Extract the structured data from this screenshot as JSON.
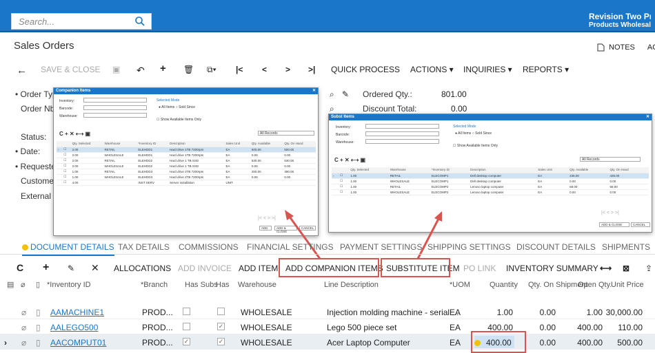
{
  "search": {
    "placeholder": "Search..."
  },
  "company": {
    "line1": "Revision Two Pro",
    "line2": "Products Wholesale"
  },
  "page": {
    "title": "Sales Orders",
    "notes": "NOTES",
    "act": "ACT"
  },
  "toolbar": {
    "save_close": "SAVE & CLOSE",
    "quick_process": "QUICK PROCESS",
    "actions": "ACTIONS ▾",
    "inquiries": "INQUIRIES ▾",
    "reports": "REPORTS ▾"
  },
  "header": {
    "order_type": "• Order Type",
    "order_nbr": "Order Nbr.",
    "status": "Status:",
    "date": "• Date:",
    "requested": "• Requested",
    "customer": "Customer",
    "external": "External R",
    "ordered_qty_label": "Ordered Qty.:",
    "ordered_qty": "801.00",
    "discount_label": "Discount Total:",
    "discount": "0.00"
  },
  "companion": {
    "title": "Companion Items",
    "inventory": "Inventory:",
    "barcode": "Barcode:",
    "warehouse": "Warehouse:",
    "selected_mode": "Selected Mode",
    "mode_options": "● All Items  ○ Sold Since",
    "show_available": "☐ Show Available Items Only",
    "all_records": "All Records",
    "columns": [
      "Qty. Selected",
      "Warehouse",
      "*Inventory ID",
      "Description",
      "Sales Unit",
      "Qty. Available",
      "Qty. On Hand"
    ],
    "rows": [
      [
        "2.00",
        "RETAIL",
        "ELEHDD1",
        "Hard drive 1TB 7200rpm",
        "EA",
        "500.00",
        "500.00"
      ],
      [
        "2.00",
        "WHOLESALE",
        "ELEHDD1",
        "Hard drive 1TB 7200rpm",
        "EA",
        "0.00",
        "0.00"
      ],
      [
        "2.00",
        "RETAIL",
        "ELEHDD2",
        "Hard drive 1 TB SSD",
        "EA",
        "530.00",
        "530.00"
      ],
      [
        "2.00",
        "WHOLESALE",
        "ELEHDD2",
        "Hard drive 1 TB SSD",
        "EA",
        "0.00",
        "0.00"
      ],
      [
        "1.00",
        "RETAIL",
        "ELEHDD3",
        "Hard drive 2TB 7200rpm",
        "EA",
        "250.00",
        "390.00"
      ],
      [
        "1.00",
        "WHOLESALE",
        "ELEHDD3",
        "Hard drive 2TB 7200rpm",
        "EA",
        "0.00",
        "0.00"
      ],
      [
        "4.00",
        "",
        "INST SERV",
        "Server installation",
        "UNIT",
        "",
        ""
      ]
    ],
    "add": "ADD",
    "add_close": "ADD & CLOSE",
    "cancel": "CANCEL"
  },
  "subst": {
    "title": "Subst Items",
    "inventory": "Inventory:",
    "barcode": "Barcode:",
    "warehouse": "Warehouse:",
    "selected_mode": "Selected Mode",
    "mode_options": "● All Items  ○ Sold Since",
    "show_available": "☐ Show Available Items Only",
    "all_records": "All Records",
    "columns": [
      "Qty. Selected",
      "Warehouse",
      "*Inventory ID",
      "Description",
      "Sales Unit",
      "Qty. Available",
      "Qty. On Hand"
    ],
    "rows": [
      [
        "1.00",
        "RETAIL",
        "ELECOMP1",
        "Dell desktop computer",
        "EA",
        "435.00",
        "435.00"
      ],
      [
        "1.00",
        "WHOLESALE",
        "ELECOMP1",
        "Dell desktop computer",
        "EA",
        "0.00",
        "0.00"
      ],
      [
        "1.00",
        "RETAIL",
        "ELECOMP2",
        "Lenovo laptop computer",
        "EA",
        "68.00",
        "68.00"
      ],
      [
        "1.00",
        "WHOLESALE",
        "ELECOMP2",
        "Lenovo laptop computer",
        "EA",
        "0.00",
        "0.00"
      ]
    ],
    "add_close": "ADD & CLOSE",
    "cancel": "CANCEL"
  },
  "tabs": [
    "DOCUMENT DETAILS",
    "TAX DETAILS",
    "COMMISSIONS",
    "FINANCIAL SETTINGS",
    "PAYMENT SETTINGS",
    "SHIPPING SETTINGS",
    "DISCOUNT DETAILS",
    "SHIPMENTS"
  ],
  "gridbar": {
    "allocations": "ALLOCATIONS",
    "add_invoice": "ADD INVOICE",
    "add_item": "ADD ITEM",
    "add_companion": "ADD COMPANION ITEMS",
    "substitute": "SUBSTITUTE ITEM",
    "po_link": "PO LINK",
    "inventory_summary": "INVENTORY SUMMARY"
  },
  "grid": {
    "columns": [
      "*Inventory ID",
      "*Branch",
      "Has Subs",
      "Has Cor",
      "Warehouse",
      "Line Description",
      "*UOM",
      "Quantity",
      "Qty. On Shipment",
      "Open Qty.",
      "Unit Price"
    ],
    "rows": [
      {
        "inv": "AAMACHINE1",
        "branch": "PROD...",
        "subs": "",
        "cor": "",
        "wh": "WHOLESALE",
        "desc": "Injection molding machine - serial ...",
        "uom": "EA",
        "qty": "1.00",
        "ship": "0.00",
        "open": "1.00",
        "price": "30,000.00"
      },
      {
        "inv": "AALEGO500",
        "branch": "PROD...",
        "subs": "",
        "cor": "✓",
        "wh": "WHOLESALE",
        "desc": "Lego 500 piece set",
        "uom": "EA",
        "qty": "400.00",
        "ship": "0.00",
        "open": "400.00",
        "price": "110.00"
      },
      {
        "inv": "AACOMPUT01",
        "branch": "PROD...",
        "subs": "✓",
        "cor": "✓",
        "wh": "WHOLESALE",
        "desc": "Acer Laptop Computer",
        "uom": "EA",
        "qty": "400.00",
        "ship": "0.00",
        "open": "400.00",
        "price": "500.00"
      }
    ]
  },
  "colors": {
    "brand": "#1a76c9",
    "highlight": "#d9534f"
  }
}
